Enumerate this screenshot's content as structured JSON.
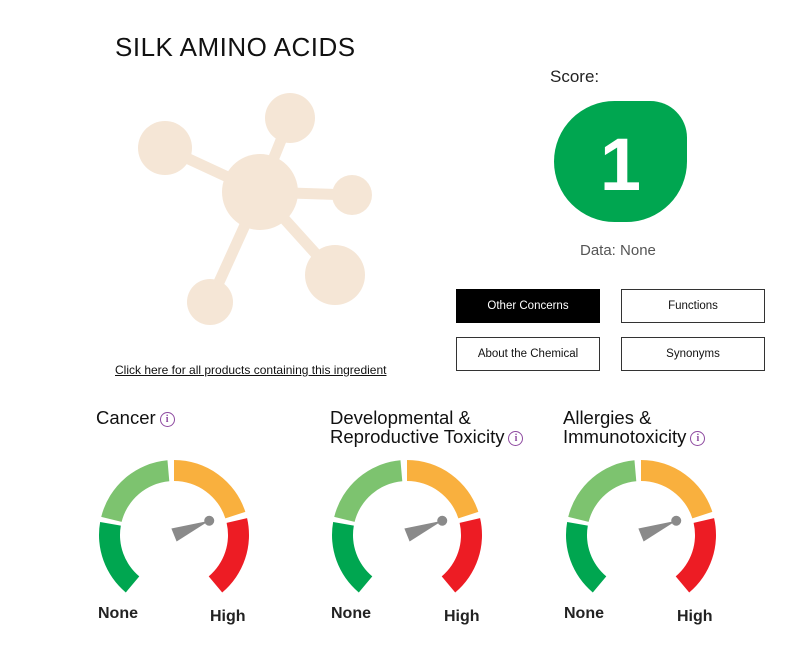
{
  "title": "SILK AMINO ACIDS",
  "score": {
    "label": "Score:",
    "value": "1",
    "color": "#00a650"
  },
  "data_availability": "Data: None",
  "buttons": {
    "other_concerns": "Other Concerns",
    "functions": "Functions",
    "about_chemical": "About the Chemical",
    "synonyms": "Synonyms"
  },
  "products_link": "Click here for all products containing this ingredient",
  "concerns": [
    {
      "title_line1": "Cancer",
      "title_line2": "",
      "info_icon": "ⓘ",
      "none_label": "None",
      "high_label": "High",
      "level": "None"
    },
    {
      "title_line1": "Developmental &",
      "title_line2": "Reproductive Toxicity",
      "info_icon": "ⓘ",
      "none_label": "None",
      "high_label": "High",
      "level": "None"
    },
    {
      "title_line1": "Allergies &",
      "title_line2": "Immunotoxicity",
      "info_icon": "ⓘ",
      "none_label": "None",
      "high_label": "High",
      "level": "None"
    }
  ],
  "colors": {
    "gauge_green_dark": "#00a650",
    "gauge_green_light": "#7dc36f",
    "gauge_orange": "#f9b03e",
    "gauge_red": "#ed1c24",
    "needle": "#8a8a8a",
    "molecule": "#f5e6d6",
    "info": "#8e4aa0"
  }
}
